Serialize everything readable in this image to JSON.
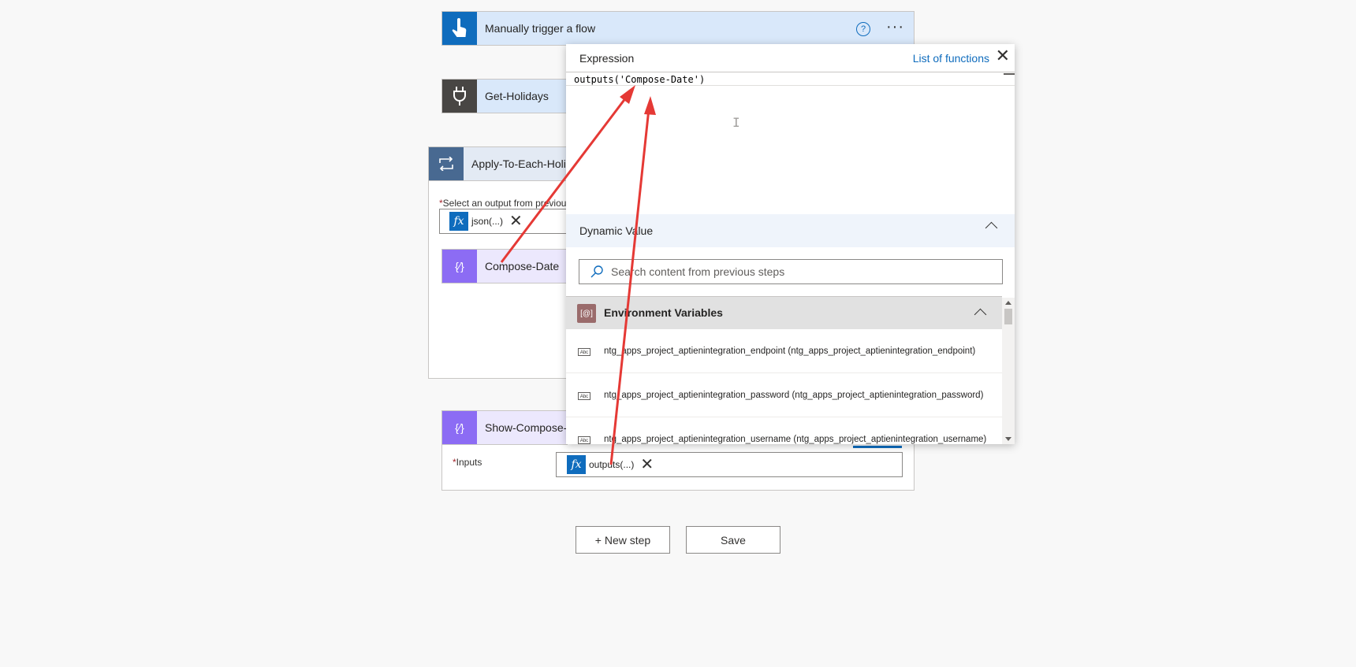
{
  "flow": {
    "trigger": {
      "title": "Manually trigger a flow"
    },
    "get_holidays": {
      "title": "Get-Holidays"
    },
    "apply_to_each": {
      "title": "Apply-To-Each-Holi",
      "field_label": "Select an output from previou",
      "token": "json(...)"
    },
    "compose_date": {
      "title": "Compose-Date"
    },
    "show_compose": {
      "title": "Show-Compose-",
      "inputs_label": "Inputs",
      "token": "outputs(...)"
    }
  },
  "buttons": {
    "new_step": "+ New step",
    "save": "Save"
  },
  "expression_panel": {
    "title": "Expression",
    "list_of_functions": "List of functions",
    "expression": "outputs('Compose-Date')",
    "dynamic_value": {
      "title": "Dynamic Value",
      "search_placeholder": "Search content from previous steps"
    },
    "environment_variables": {
      "title": "Environment Variables",
      "items": [
        "ntg_apps_project_aptienintegration_endpoint (ntg_apps_project_aptienintegration_endpoint)",
        "ntg_apps_project_aptienintegration_password (ntg_apps_project_aptienintegration_password)",
        "ntg_apps_project_aptienintegration_username (ntg_apps_project_aptienintegration_username)"
      ]
    }
  },
  "colors": {
    "accent": "#0f6cbd",
    "arrow": "#e53935",
    "compose_icon": "#8c6cf4",
    "loop_icon": "#486991",
    "connector_icon": "#484644"
  }
}
